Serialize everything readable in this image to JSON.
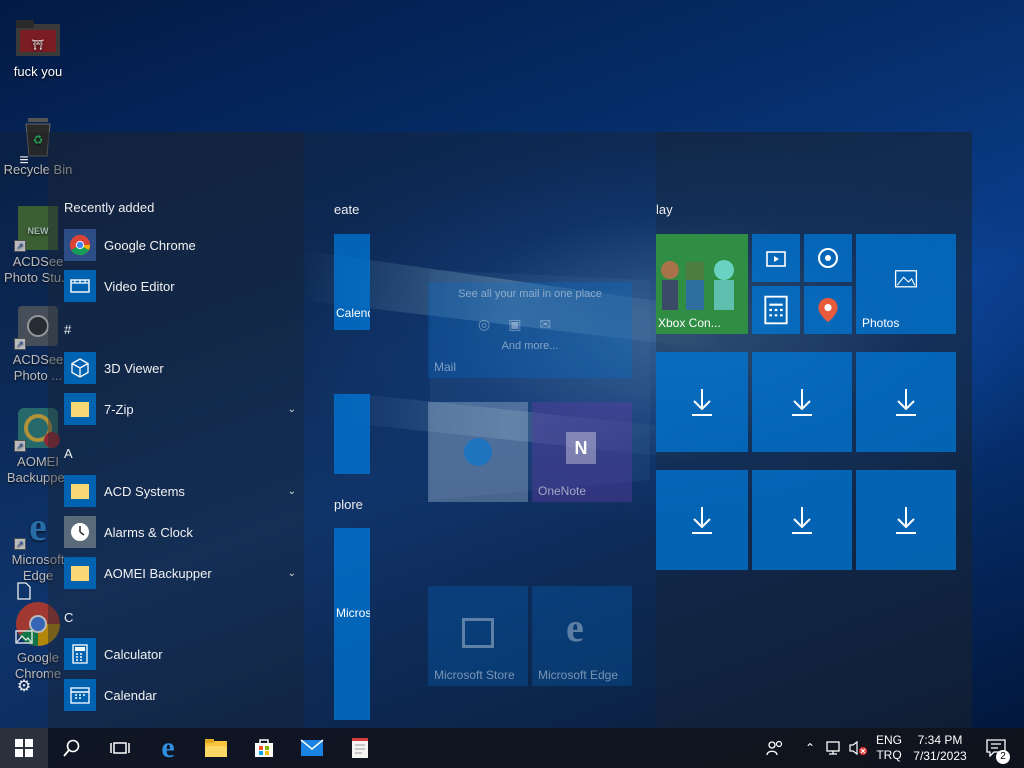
{
  "desktop": {
    "icons": [
      {
        "label": "fuck you"
      },
      {
        "label": "Recycle Bin"
      },
      {
        "label": "ACDSee Photo Stu..."
      },
      {
        "label": "ACDSee Photo ..."
      },
      {
        "label": "AOMEI Backupper"
      },
      {
        "label": "Microsoft Edge"
      },
      {
        "label": "Google Chrome"
      }
    ]
  },
  "start_menu": {
    "rail_icons": [
      "hamburger-menu-icon",
      "documents-icon",
      "pictures-icon",
      "settings-icon"
    ],
    "recently_added_header": "Recently added",
    "sections": {
      "hash": "#",
      "a": "A",
      "c": "C"
    },
    "apps": [
      {
        "name": "Google Chrome",
        "icon": "chrome-icon"
      },
      {
        "name": "Video Editor",
        "icon": "video-editor-icon"
      },
      {
        "name": "3D Viewer",
        "icon": "3d-viewer-icon"
      },
      {
        "name": "7-Zip",
        "icon": "folder-icon",
        "expandable": true
      },
      {
        "name": "ACD Systems",
        "icon": "folder-icon",
        "expandable": true
      },
      {
        "name": "Alarms & Clock",
        "icon": "alarm-clock-icon"
      },
      {
        "name": "AOMEI Backupper",
        "icon": "folder-icon",
        "expandable": true
      },
      {
        "name": "Calculator",
        "icon": "calculator-icon"
      },
      {
        "name": "Calendar",
        "icon": "calendar-icon"
      }
    ],
    "groups": {
      "create": "eate",
      "explore": "plore",
      "play": "lay"
    },
    "tiles": {
      "calendar": "Calend",
      "mail_promo": "See all your mail in one place",
      "mail_more": "And more...",
      "mail": "Mail",
      "onenote": "OneNote",
      "microsoft_store_partial": "Micros",
      "microsoft_store": "Microsoft Store",
      "microsoft_edge": "Microsoft Edge",
      "xbox": "Xbox Con...",
      "photos": "Photos"
    }
  },
  "taskbar": {
    "language_line1": "ENG",
    "language_line2": "TRQ",
    "time": "7:34 PM",
    "date": "7/31/2023",
    "notification_count": "2"
  },
  "colors": {
    "accent": "#0078d7",
    "taskbar": "#10141c",
    "tile": "#1a7fd6"
  }
}
